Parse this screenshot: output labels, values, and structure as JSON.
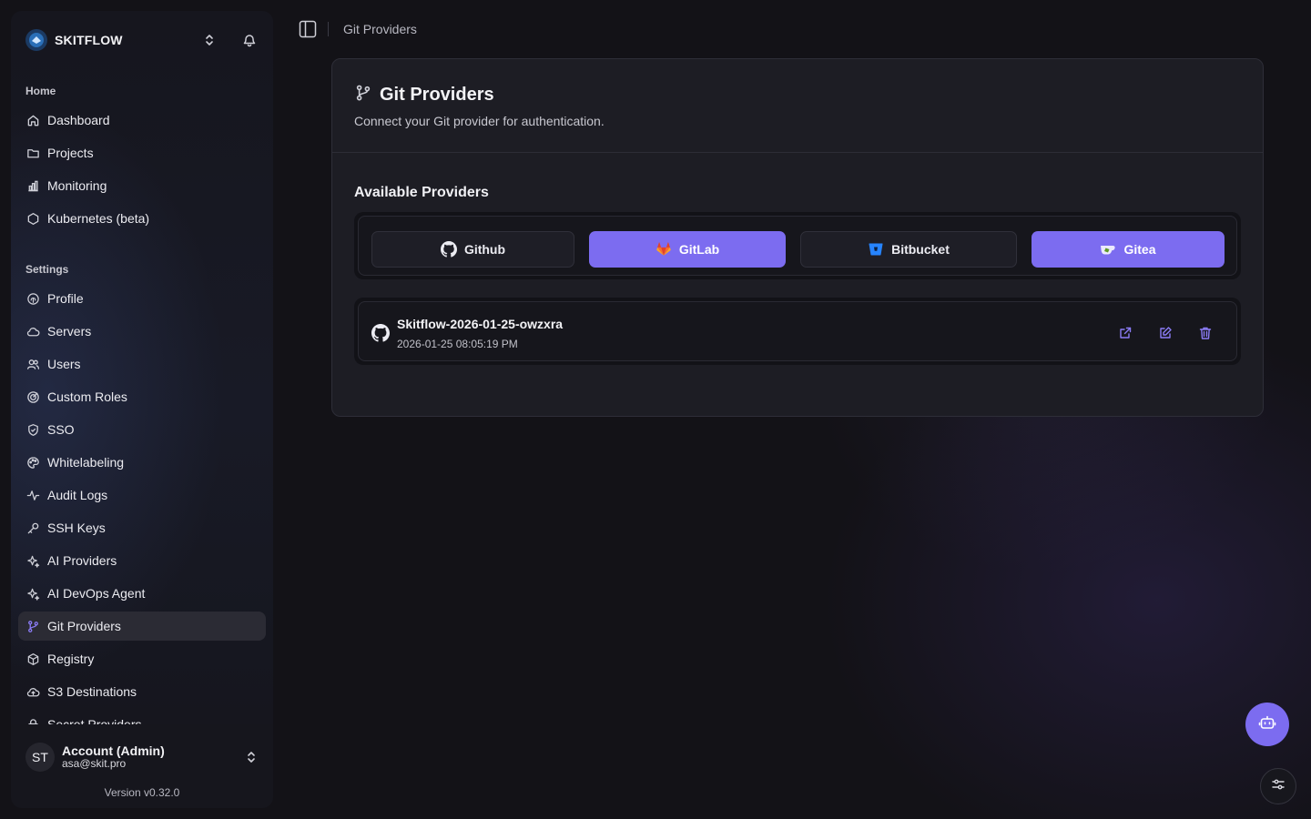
{
  "brand": {
    "name": "SKITFLOW",
    "logo_icon": "skitflow-logo-icon"
  },
  "sidebar": {
    "home_label": "Home",
    "home_items": [
      {
        "label": "Dashboard",
        "icon": "home-icon"
      },
      {
        "label": "Projects",
        "icon": "folder-icon"
      },
      {
        "label": "Monitoring",
        "icon": "bar-chart-icon"
      },
      {
        "label": "Kubernetes (beta)",
        "icon": "hexagon-icon"
      }
    ],
    "settings_label": "Settings",
    "settings_items": [
      {
        "label": "Profile",
        "icon": "fingerprint-icon"
      },
      {
        "label": "Servers",
        "icon": "cloud-icon"
      },
      {
        "label": "Users",
        "icon": "users-icon"
      },
      {
        "label": "Custom Roles",
        "icon": "target-icon"
      },
      {
        "label": "SSO",
        "icon": "shield-icon"
      },
      {
        "label": "Whitelabeling",
        "icon": "palette-icon"
      },
      {
        "label": "Audit Logs",
        "icon": "activity-icon"
      },
      {
        "label": "SSH Keys",
        "icon": "key-icon"
      },
      {
        "label": "AI Providers",
        "icon": "sparkles-icon"
      },
      {
        "label": "AI DevOps Agent",
        "icon": "sparkles-icon"
      },
      {
        "label": "Git Providers",
        "icon": "git-branch-icon",
        "active": true
      },
      {
        "label": "Registry",
        "icon": "package-icon"
      },
      {
        "label": "S3 Destinations",
        "icon": "cloud-upload-icon"
      },
      {
        "label": "Secret Providers",
        "icon": "lock-icon"
      }
    ]
  },
  "account": {
    "initials": "ST",
    "name": "Account (Admin)",
    "email": "asa@skit.pro"
  },
  "version": "Version v0.32.0",
  "header": {
    "breadcrumb": "Git Providers"
  },
  "card": {
    "title": "Git Providers",
    "description": "Connect your Git provider for authentication.",
    "available_label": "Available Providers",
    "providers": [
      {
        "label": "Github",
        "icon": "github-icon",
        "style": "dark"
      },
      {
        "label": "GitLab",
        "icon": "gitlab-icon",
        "style": "purple"
      },
      {
        "label": "Bitbucket",
        "icon": "bitbucket-icon",
        "style": "dark"
      },
      {
        "label": "Gitea",
        "icon": "gitea-icon",
        "style": "purple"
      }
    ],
    "connected": [
      {
        "name": "Skitflow-2026-01-25-owzxra",
        "date": "2026-01-25 08:05:19 PM",
        "provider_icon": "github-icon"
      }
    ]
  },
  "colors": {
    "accent": "#7c6cf0",
    "background": "#131217",
    "card": "#1d1d24"
  }
}
